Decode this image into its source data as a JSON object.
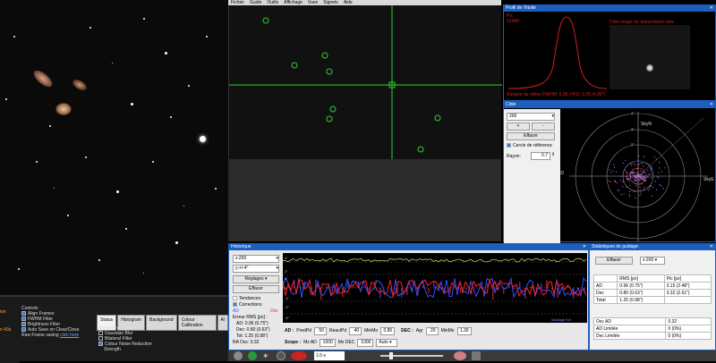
{
  "menubar": [
    "Fichier",
    "Guide",
    "Outils",
    "Affichage",
    "Vues",
    "Signets",
    "Aide"
  ],
  "profile": {
    "title": "Profil de l'étoile",
    "label_pic": "Pic",
    "label_value": "12468",
    "click_hint": "Click image for interpolated view",
    "fwhm_text": "Rangee du milieu FWHM: 5.38, HFD: 3.29 (4.88\")"
  },
  "cible": {
    "title": "Cible",
    "zoom_option": "200",
    "plus_label": "+",
    "minus_label": "-",
    "clear_label": "Effacer",
    "ref_circle_label": "Cercle de référence",
    "radius_label": "Rayon:",
    "radius_value": "0.7",
    "axis_ad": "AD",
    "axis_skyn": "SkyN",
    "axis_skye": "SkyE",
    "ring_labels": [
      "4\"",
      "3\"",
      "2\""
    ]
  },
  "history": {
    "title": "Historique",
    "x_select": "x:200",
    "y_select": "y:+/-4\"",
    "settings_label": "Réglages",
    "clear_label": "Effacer",
    "trends_label": "Tendances",
    "corrections_label": "Corrections",
    "legend_ad": "AD",
    "legend_dec": "Dec",
    "rms_title": "Erreur RMS [px] :",
    "rms_ad": "AD: 0.96 (0.75\")",
    "rms_dec": "Dec: 0.80 (0.63\")",
    "rms_tot": "Tot: 1.25 (0.98\")",
    "ra_osc": "RA Osc: 0.32",
    "y_ticks": [
      "4\"",
      "2\"",
      "1\"",
      "0",
      "-1\"",
      "-2\"",
      "-4\""
    ],
    "status_right": "Guidage Ext",
    "ad_label": "AD :",
    "predpd_label": "PredPd",
    "predpd_value": "50",
    "reactpd_label": "ReactPd",
    "reactpd_value": "40",
    "minmo_label": "MinMo",
    "minmo_value": "0.85",
    "dec_label": "DEC :",
    "agr_label": "Agr",
    "agr_value": "20",
    "minmo2_label": "MinMo",
    "minmo2_value": "1.30",
    "scope_label": "Scope :",
    "mxad_label": "Mx AD",
    "mxad_value": "1000",
    "mxdec_label": "Mx DEC",
    "mxdec_value": "1000",
    "auto_value": "Auto"
  },
  "stats": {
    "title": "Statistiques de guidage",
    "clear_label": "Effacer",
    "x_select": "x:200",
    "headers": [
      "",
      "RMS [px]",
      "Pic [px]"
    ],
    "rows": [
      [
        "AD",
        "0.96 (0.75\")",
        "3.15 (2.48\")"
      ],
      [
        "Dec",
        "0.80 (0.63\")",
        "3.32 (2.61\")"
      ],
      [
        "Total",
        "1.25 (0.98\")",
        ""
      ]
    ],
    "rows2": [
      [
        "Osc AD",
        "0.32"
      ],
      [
        "AD Limitée",
        "0 (0%)"
      ],
      [
        "Dec Limitée",
        "0 (0%)"
      ]
    ]
  },
  "controls": {
    "title": "Controls",
    "items": [
      "Align Frames",
      "FWHM Filter",
      "Brightness Filter",
      "Auto Save on Clear/Close"
    ],
    "raw_saving": "Raw Frame saving",
    "click_here": "click here",
    "left_clip": "ion",
    "left_clip2": "n 43s",
    "tabs": [
      "Status",
      "Histogram",
      "Background",
      "Colour Calibration",
      "Al"
    ],
    "noise_title": "Noise Reduction",
    "noise_items": [
      "Gaussian Blur",
      "Bilateral Filter",
      "Colour Noise Reduction"
    ],
    "strength": "Strength"
  },
  "toolbar": {
    "exposure": "1.0 s"
  },
  "colors": {
    "accent_blue": "#1c5fbf",
    "ra_line": "#3b4cff",
    "dec_line": "#ff2020",
    "snr_line": "#e0e060"
  }
}
